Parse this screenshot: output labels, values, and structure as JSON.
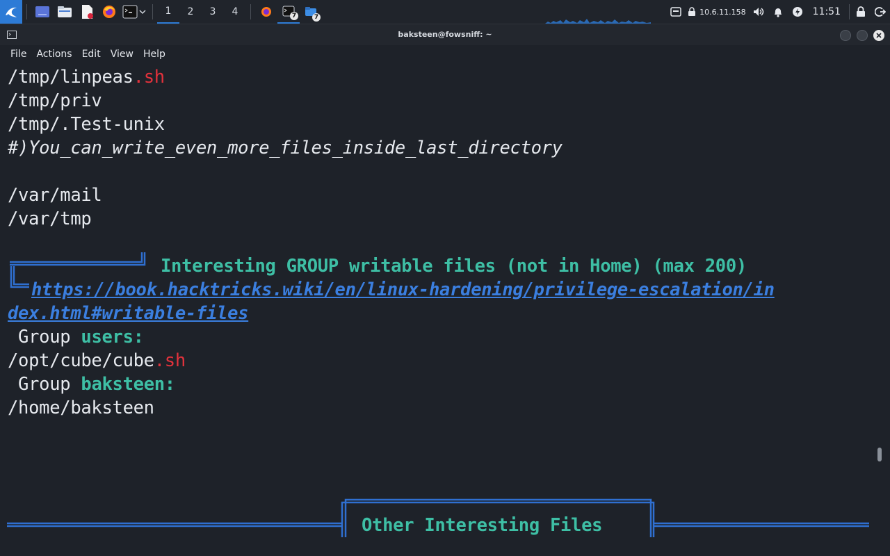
{
  "panel": {
    "workspaces": [
      "1",
      "2",
      "3",
      "4"
    ],
    "active_workspace": "1",
    "terminal_badge": "7",
    "files_badge": "7",
    "ip": "10.6.11.158",
    "clock": "11:51"
  },
  "window": {
    "title": "baksteen@fowsniff: ~",
    "menu": [
      "File",
      "Actions",
      "Edit",
      "View",
      "Help"
    ]
  },
  "terminal": {
    "line1_path": "/tmp/linpeas",
    "line1_ext": ".sh",
    "line2": "/tmp/priv",
    "line3": "/tmp/.Test-unix",
    "line4": "#)You_can_write_even_more_files_inside_last_directory",
    "line5": "/var/mail",
    "line6": "/var/tmp",
    "section1_title": "Interesting GROUP writable files (not in Home) (max 200)",
    "link_part1": "https://book.hacktricks.wiki/en/linux-hardening/privilege-escalation/in",
    "link_part2": "dex.html#writable-files",
    "group1_prefix": " Group",
    "group1_name": "users:",
    "cube_path": "/opt/cube/cube",
    "cube_ext": ".sh",
    "group2_prefix": " Group",
    "group2_name": "baksteen:",
    "home_path": "/home/baksteen",
    "section2_title": "Other Interesting Files"
  },
  "colors": {
    "accent": "#2d7bd6",
    "teal": "#3ebfa5",
    "red": "#e3323c",
    "link": "#3b7fe0",
    "box": "#2f6fd0"
  }
}
